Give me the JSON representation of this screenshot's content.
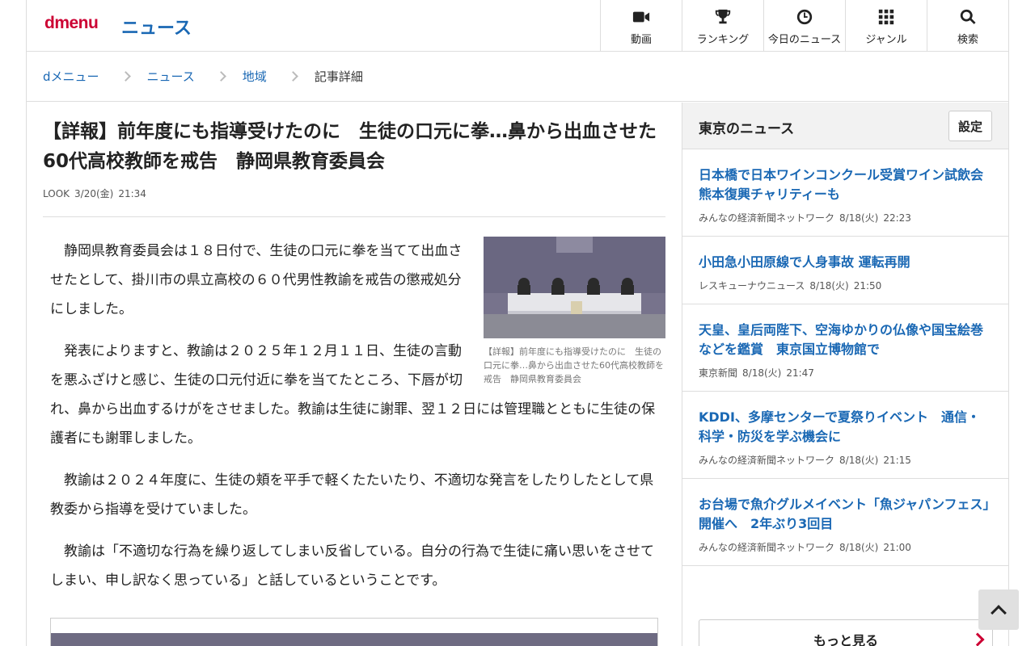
{
  "header": {
    "logo": "dmenu",
    "section": "ニュース",
    "nav": [
      {
        "label": "動画",
        "icon": "video-camera-icon"
      },
      {
        "label": "ランキング",
        "icon": "trophy-icon"
      },
      {
        "label": "今日のニュース",
        "icon": "clock-icon"
      },
      {
        "label": "ジャンル",
        "icon": "grid-icon"
      },
      {
        "label": "検索",
        "icon": "search-icon"
      }
    ]
  },
  "breadcrumb": [
    "dメニュー",
    "ニュース",
    "地域",
    "記事詳細"
  ],
  "article": {
    "headline": "【詳報】前年度にも指導受けたのに　生徒の口元に拳…鼻から出血させた60代高校教師を戒告　静岡県教育委員会",
    "source": "LOOK",
    "date": "3/20(金)",
    "time": "21:34",
    "caption": "【詳報】前年度にも指導受けたのに　生徒の口元に拳…鼻から出血させた60代高校教師を戒告　静岡県教育委員会",
    "paragraphs": [
      "静岡県教育委員会は１８日付で、生徒の口元に拳を当てて出血させたとして、掛川市の県立高校の６０代男性教諭を戒告の懲戒処分にしました。",
      "発表によりますと、教諭は２０２５年１２月１１日、生徒の言動を悪ふざけと感じ、生徒の口元付近に拳を当てたところ、下唇が切れ、鼻から出血するけがをさせました。教諭は生徒に謝罪、翌１２日には管理職とともに生徒の保護者にも謝罪しました。",
      "教諭は２０２４年度に、生徒の頬を平手で軽くたたいたり、不適切な発言をしたりしたとして県教委から指導を受けていました。",
      "教諭は「不適切な行為を繰り返してしまい反省している。自分の行為で生徒に痛い思いをさせてしまい、申し訳なく思っている」と話しているということです。"
    ]
  },
  "sidebar": {
    "title": "東京のニュース",
    "settings_label": "設定",
    "items": [
      {
        "title": "日本橋で日本ワインコンクール受賞ワイン試飲会　熊本復興チャリティーも",
        "source": "みんなの経済新聞ネットワーク",
        "date": "8/18(火)",
        "time": "22:23"
      },
      {
        "title": "小田急小田原線で人身事故 運転再開",
        "source": "レスキューナウニュース",
        "date": "8/18(火)",
        "time": "21:50"
      },
      {
        "title": "天皇、皇后両陛下、空海ゆかりの仏像や国宝絵巻などを鑑賞　東京国立博物館で",
        "source": "東京新聞",
        "date": "8/18(火)",
        "time": "21:47"
      },
      {
        "title": "KDDI、多摩センターで夏祭りイベント　通信・科学・防災を学ぶ機会に",
        "source": "みんなの経済新聞ネットワーク",
        "date": "8/18(火)",
        "time": "21:15"
      },
      {
        "title": "お台場で魚介グルメイベント「魚ジャパンフェス」開催へ　2年ぶり3回目",
        "source": "みんなの経済新聞ネットワーク",
        "date": "8/18(火)",
        "time": "21:00"
      }
    ],
    "more_label": "もっと見る"
  }
}
